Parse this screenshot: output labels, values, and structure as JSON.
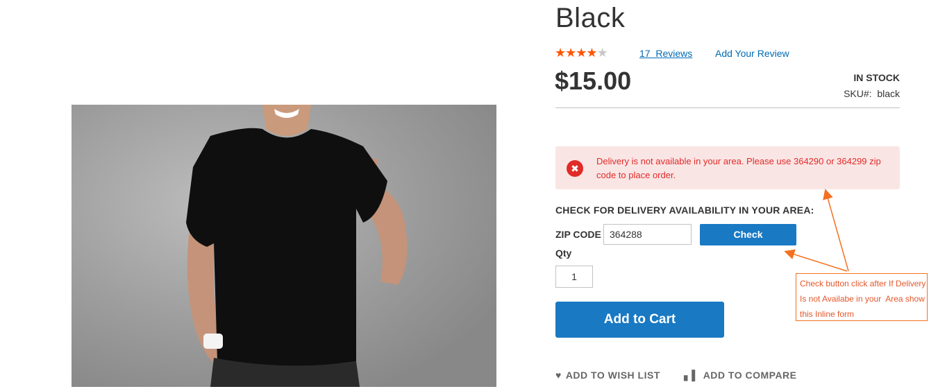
{
  "product": {
    "title": "Black",
    "rating_stars_filled": 4,
    "rating_stars_total": 5,
    "reviews_link": "17  Reviews",
    "add_review": "Add Your Review",
    "price": "$15.00",
    "stock_status": "IN STOCK",
    "sku_label": "SKU#:",
    "sku_value": "black"
  },
  "delivery": {
    "error_message": "Delivery is not available in your area. Please use 364290 or 364299 zip code to place order.",
    "heading": "CHECK FOR DELIVERY AVAILABILITY IN YOUR AREA:",
    "zip_label": "ZIP CODE",
    "zip_value": "364288",
    "check_button": "Check"
  },
  "purchase": {
    "qty_label": "Qty",
    "qty_value": "1",
    "add_to_cart": "Add to Cart"
  },
  "actions": {
    "wish_list": "ADD TO WISH LIST",
    "compare": "ADD TO COMPARE"
  },
  "annotation": {
    "text": "Check button click after If Delivery Is not Availabe in your  Area show this Inline form",
    "color": "#f47020"
  },
  "colors": {
    "primary_blue": "#1979c3",
    "link_blue": "#006bb4",
    "error_red": "#e02b27",
    "error_bg": "#fae5e5",
    "star_orange": "#ff5501"
  },
  "icons": {
    "error": "x-circle-icon",
    "wish": "heart-icon",
    "compare": "bar-chart-icon"
  }
}
